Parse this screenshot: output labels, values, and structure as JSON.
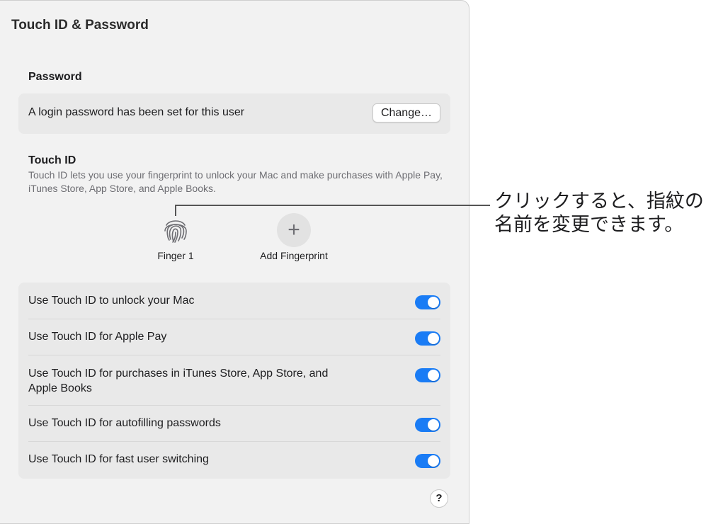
{
  "window": {
    "title": "Touch ID & Password"
  },
  "password": {
    "heading": "Password",
    "status": "A login password has been set for this user",
    "change_label": "Change…"
  },
  "touch_id": {
    "heading": "Touch ID",
    "description": "Touch ID lets you use your fingerprint to unlock your Mac and make purchases with Apple Pay, iTunes Store, App Store, and Apple Books.",
    "fingerprints": [
      {
        "label": "Finger 1",
        "icon": "fingerprint-icon"
      }
    ],
    "add_label": "Add Fingerprint",
    "add_icon": "plus-icon"
  },
  "options": [
    {
      "label": "Use Touch ID to unlock your Mac",
      "on": true
    },
    {
      "label": "Use Touch ID for Apple Pay",
      "on": true
    },
    {
      "label": "Use Touch ID for purchases in iTunes Store, App Store, and Apple Books",
      "on": true
    },
    {
      "label": "Use Touch ID for autofilling passwords",
      "on": true
    },
    {
      "label": "Use Touch ID for fast user switching",
      "on": true
    }
  ],
  "help_label": "?",
  "callout": {
    "text": "クリックすると、指紋の名前を変更できます。"
  },
  "colors": {
    "accent": "#1a7cf5",
    "background": "#f2f2f2",
    "card": "#e9e9e9"
  }
}
